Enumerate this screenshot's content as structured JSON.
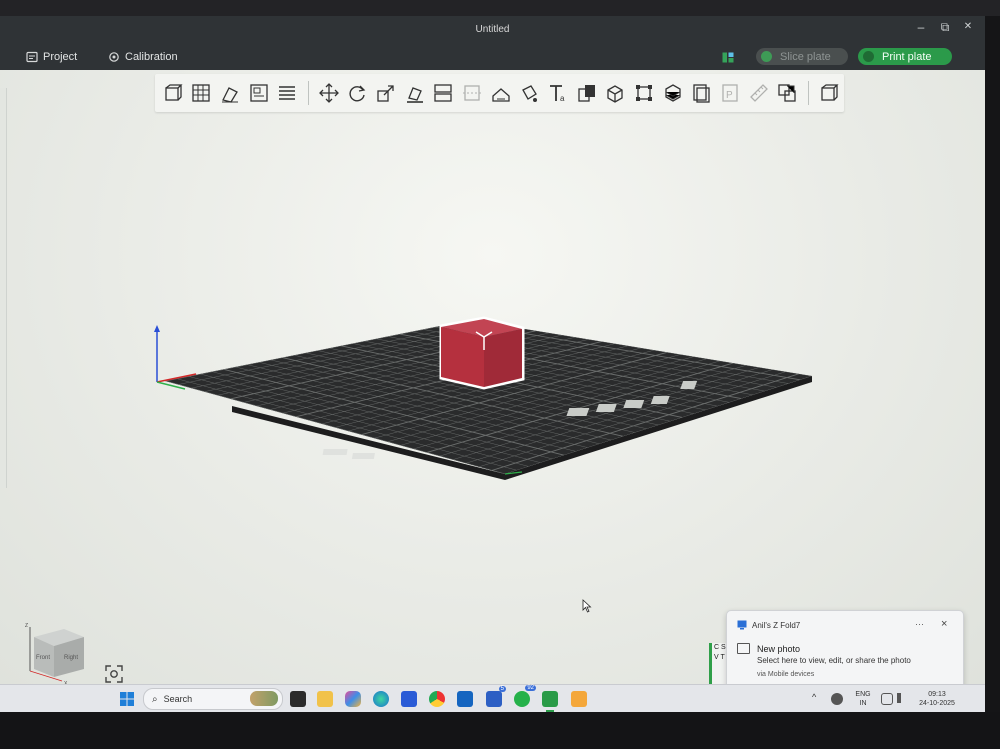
{
  "window": {
    "title": "Untitled",
    "minimize_glyph": "–",
    "maximize_glyph": "⧉",
    "close_glyph": "✕"
  },
  "menubar": {
    "project_label": "Project",
    "calibration_label": "Calibration",
    "slice_label": "Slice plate",
    "print_label": "Print plate"
  },
  "toolbar": {
    "groups": [
      [
        "add-object-icon",
        "arrange-grid-icon",
        "auto-orient-icon",
        "plate-icon",
        "layers-list-icon"
      ],
      [
        "move-icon",
        "rotate-icon",
        "scale-icon",
        "lay-on-face-icon",
        "split-icon",
        "cut-icon",
        "support-paint-icon",
        "seam-paint-icon",
        "text-tool-icon",
        "emboss-icon",
        "assembly-icon",
        "measure-box-icon",
        "boolean-icon",
        "variable-layer-icon",
        "copy-icon",
        "paste-icon",
        "ruler-icon"
      ],
      [
        "split-objects-icon"
      ]
    ],
    "disabled": [
      "cut-icon",
      "copy-icon",
      "paste-icon"
    ]
  },
  "viewport": {
    "object": "cube",
    "object_color": "#b5303e",
    "bed_color": "#2a2b2c",
    "grid_color": "#6b6e6d",
    "navcube_labels": {
      "front": "Front",
      "right": "Right",
      "z": "Z",
      "x": "X"
    }
  },
  "taskbar": {
    "search_placeholder": "Search",
    "language_top": "ENG",
    "language_bottom": "IN",
    "time": "09:13",
    "date": "24-10-2025",
    "badges": {
      "teams": "5",
      "whatsapp": "92"
    }
  },
  "notification": {
    "app_name": "Anil's Z Fold7",
    "title": "New photo",
    "body": "Select here to view, edit, or share the photo",
    "footer": "via Mobile devices",
    "more_label": "···",
    "edge_text": "C S V T"
  },
  "colors": {
    "accent_green": "#2b9a4a",
    "titlebar": "#2f3336"
  }
}
